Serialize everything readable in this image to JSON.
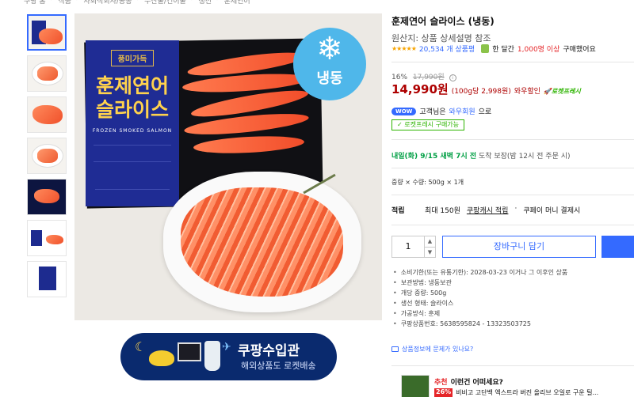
{
  "breadcrumb": [
    "쿠팡 홈",
    "식품",
    "사회적회사/공동",
    "수산물/건어물",
    "생선",
    "훈제연어"
  ],
  "thumbnails": [
    "thumb-1",
    "thumb-2",
    "thumb-3",
    "thumb-4",
    "thumb-5",
    "thumb-6",
    "thumb-7"
  ],
  "image": {
    "brand": "풍미가득",
    "title_line1": "훈제연어",
    "title_line2": "슬라이스",
    "subtitle": "FROZEN SMOKED SALMON",
    "frozen_label": "냉동",
    "frozen_icon": "snowflake-icon"
  },
  "banner": {
    "title": "쿠팡수입관",
    "subtitle": "해외상품도 로켓배송"
  },
  "product": {
    "title": "훈제연어 슬라이스 (냉동)",
    "origin": "원산지: 상품 상세설명 참조",
    "stars": "★★★★★",
    "rating_count": "20,534 개 상품평",
    "buyers_prefix": "한 달간",
    "buyers_count": "1,000명 이상",
    "buyers_suffix": "구매했어요",
    "discount_pct": "16%",
    "original_price": "17,990원",
    "sale_price": "14,990원",
    "unit_price": "(100g당 2,998원)",
    "wow_sale": "와우할인",
    "rocket_fresh_label": "로켓프레시",
    "wow_badge": "WOW",
    "wow_text_pre": "고객님은",
    "wow_text_link": "와우회원",
    "wow_text_post": "으로",
    "fresh_badge": "✓ 로켓프레시 구매가능",
    "delivery_date": "내일(화) 9/15 새벽 7시 전",
    "delivery_rest": "도착 보장(밤 12시 전 주문 시)",
    "option": "중량 × 수량: 500g × 1개",
    "points_label": "적립",
    "points_max": "최대 150원",
    "points_cash": "쿠팡캐시 적립",
    "points_sep": "·",
    "points_money": "쿠페이 머니 결제시",
    "quantity": "1",
    "cart_button": "장바구니 담기",
    "details": [
      "소비기한(또는 유통기한): 2028-03-23 이거나 그 이후인 상품",
      "보관방법: 냉동보관",
      "개당 중량: 500g",
      "생선 형태: 슬라이스",
      "가공방식: 훈제",
      "쿠팡상품번호: 5638595824 - 13323503725"
    ],
    "report": "상품정보에 문제가 있나요?"
  },
  "recommend": {
    "tag": "추천",
    "title": "이런건 어떠세요?",
    "discount": "26%",
    "item": "비비고 고단백 엑스트라 버진 올리브 오일로 구운 틸..."
  },
  "colors": {
    "accent": "#346aff",
    "price": "#ae0000",
    "fresh": "#2db400",
    "package": "#1f2c94",
    "frozen_badge": "#4fb7ea"
  }
}
